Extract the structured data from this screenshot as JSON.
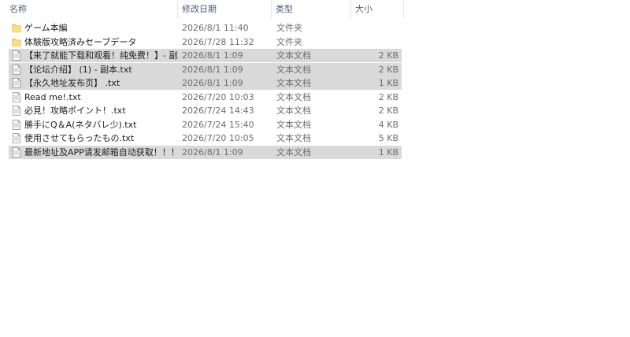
{
  "columns": {
    "name": "名称",
    "date": "修改日期",
    "type": "类型",
    "size": "大小"
  },
  "files": [
    {
      "icon": "folder-icon",
      "name": "ゲーム本編",
      "date": "2026/8/1 11:40",
      "type": "文件夹",
      "size": "",
      "selected": false
    },
    {
      "icon": "folder-icon",
      "name": "体験版攻略済みセーブデータ",
      "date": "2026/7/28 11:32",
      "type": "文件夹",
      "size": "",
      "selected": false
    },
    {
      "icon": "text-file-icon",
      "name": "【来了就能下载和观看！纯免费！】- 副…",
      "date": "2026/8/1 1:09",
      "type": "文本文档",
      "size": "2 KB",
      "selected": true
    },
    {
      "icon": "text-file-icon",
      "name": "【论坛介绍】 (1) - 副本.txt",
      "date": "2026/8/1 1:09",
      "type": "文本文档",
      "size": "2 KB",
      "selected": true
    },
    {
      "icon": "text-file-icon",
      "name": "【永久地址发布页】 .txt",
      "date": "2026/8/1 1:09",
      "type": "文本文档",
      "size": "1 KB",
      "selected": true
    },
    {
      "icon": "text-file-icon",
      "name": "Read me!.txt",
      "date": "2026/7/20 10:03",
      "type": "文本文档",
      "size": "2 KB",
      "selected": false
    },
    {
      "icon": "text-file-icon",
      "name": "必見！攻略ポイント！.txt",
      "date": "2026/7/24 14:43",
      "type": "文本文档",
      "size": "2 KB",
      "selected": false
    },
    {
      "icon": "text-file-icon",
      "name": "勝手にQ＆A(ネタバレ少).txt",
      "date": "2026/7/24 15:40",
      "type": "文本文档",
      "size": "4 KB",
      "selected": false
    },
    {
      "icon": "text-file-icon",
      "name": "使用させてもらったもの.txt",
      "date": "2026/7/20 10:05",
      "type": "文本文档",
      "size": "5 KB",
      "selected": false
    },
    {
      "icon": "text-file-icon",
      "name": "最新地址及APP请发邮箱自动获取！！！…",
      "date": "2026/8/1 1:09",
      "type": "文本文档",
      "size": "1 KB",
      "selected": true
    }
  ]
}
